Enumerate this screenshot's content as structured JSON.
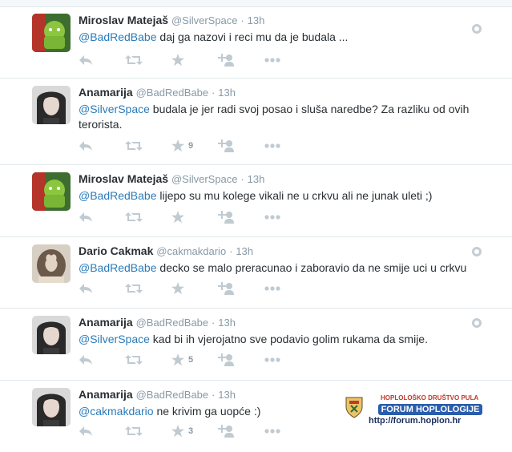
{
  "tweets": [
    {
      "name": "Miroslav Matejaš",
      "handle": "@SilverSpace",
      "time": "13h",
      "mention": "@BadRedBabe",
      "body": " daj ga nazovi i reci mu da je budala ...",
      "favorites": "",
      "avatar": "android-icon"
    },
    {
      "name": "Anamarija",
      "handle": "@BadRedBabe",
      "time": "13h",
      "mention": "@SilverSpace",
      "body": " budala je jer radi svoj posao i sluša naredbe? Za razliku od ovih terorista.",
      "favorites": "9",
      "avatar": "woman-photo"
    },
    {
      "name": "Miroslav Matejaš",
      "handle": "@SilverSpace",
      "time": "13h",
      "mention": "@BadRedBabe",
      "body": " lijepo su mu kolege vikali ne u crkvu ali ne junak uleti ;)",
      "favorites": "",
      "avatar": "android-icon"
    },
    {
      "name": "Dario Cakmak",
      "handle": "@cakmakdario",
      "time": "13h",
      "mention": "@BadRedBabe",
      "body": " decko se malo preracunao i zaboravio da ne smije uci u crkvu",
      "favorites": "",
      "avatar": "apple-haircut-photo"
    },
    {
      "name": "Anamarija",
      "handle": "@BadRedBabe",
      "time": "13h",
      "mention": "@SilverSpace",
      "body": " kad bi ih vjerojatno sve podavio golim rukama da smije.",
      "favorites": "5",
      "avatar": "woman-photo"
    },
    {
      "name": "Anamarija",
      "handle": "@BadRedBabe",
      "time": "13h",
      "mention": "@cakmakdario",
      "body": " ne krivim ga uopće :)",
      "favorites": "3",
      "avatar": "woman-photo"
    }
  ],
  "watermark": {
    "line1": "HOPLOLOŠKO DRUŠTVO PULA",
    "line2": "FORUM HOPLOLOGIJE",
    "line3": "http://forum.hoplon.hr"
  },
  "colors": {
    "link": "#2b7bb9",
    "muted": "#8899a6",
    "text": "#292f33",
    "border": "#e1e8ed"
  }
}
